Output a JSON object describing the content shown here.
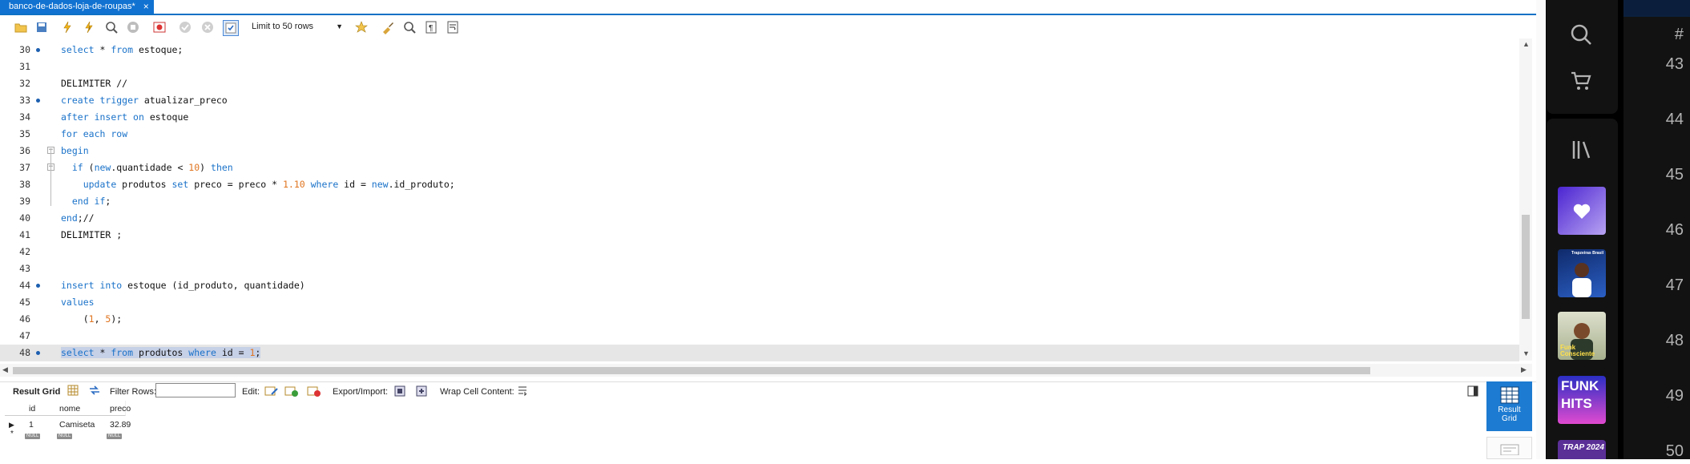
{
  "tab": {
    "title": "banco-de-dados-loja-de-roupas*",
    "close": "×"
  },
  "toolbar": {
    "limit_label": "Limit to 50 rows"
  },
  "editor": {
    "lines": [
      {
        "n": "30",
        "dot": true,
        "code": [
          {
            "k": "kw",
            "t": "select"
          },
          {
            "t": " * "
          },
          {
            "k": "kw",
            "t": "from"
          },
          {
            "t": " estoque;"
          }
        ]
      },
      {
        "n": "31",
        "dot": false,
        "code": []
      },
      {
        "n": "32",
        "dot": false,
        "code": [
          {
            "t": "DELIMITER //"
          }
        ]
      },
      {
        "n": "33",
        "dot": true,
        "code": [
          {
            "k": "kw",
            "t": "create"
          },
          {
            "t": " "
          },
          {
            "k": "kw",
            "t": "trigger"
          },
          {
            "t": " atualizar_preco"
          }
        ]
      },
      {
        "n": "34",
        "dot": false,
        "code": [
          {
            "k": "kw",
            "t": "after"
          },
          {
            "t": " "
          },
          {
            "k": "kw",
            "t": "insert"
          },
          {
            "t": " "
          },
          {
            "k": "kw",
            "t": "on"
          },
          {
            "t": " estoque"
          }
        ]
      },
      {
        "n": "35",
        "dot": false,
        "code": [
          {
            "k": "kw",
            "t": "for"
          },
          {
            "t": " "
          },
          {
            "k": "kw",
            "t": "each"
          },
          {
            "t": " "
          },
          {
            "k": "kw",
            "t": "row"
          }
        ]
      },
      {
        "n": "36",
        "dot": false,
        "fold": true,
        "code": [
          {
            "k": "kw",
            "t": "begin"
          }
        ]
      },
      {
        "n": "37",
        "dot": false,
        "fold": true,
        "code": [
          {
            "t": "  "
          },
          {
            "k": "kw",
            "t": "if"
          },
          {
            "t": " ("
          },
          {
            "k": "kw",
            "t": "new"
          },
          {
            "t": ".quantidade < "
          },
          {
            "k": "num",
            "t": "10"
          },
          {
            "t": ") "
          },
          {
            "k": "kw",
            "t": "then"
          }
        ]
      },
      {
        "n": "38",
        "dot": false,
        "code": [
          {
            "t": "    "
          },
          {
            "k": "kw",
            "t": "update"
          },
          {
            "t": " produtos "
          },
          {
            "k": "kw",
            "t": "set"
          },
          {
            "t": " preco = preco * "
          },
          {
            "k": "num",
            "t": "1.10"
          },
          {
            "t": " "
          },
          {
            "k": "kw",
            "t": "where"
          },
          {
            "t": " id = "
          },
          {
            "k": "kw",
            "t": "new"
          },
          {
            "t": ".id_produto;"
          }
        ]
      },
      {
        "n": "39",
        "dot": false,
        "code": [
          {
            "t": "  "
          },
          {
            "k": "kw",
            "t": "end if"
          },
          {
            "t": ";"
          }
        ]
      },
      {
        "n": "40",
        "dot": false,
        "code": [
          {
            "k": "kw",
            "t": "end"
          },
          {
            "t": ";//"
          }
        ]
      },
      {
        "n": "41",
        "dot": false,
        "code": [
          {
            "t": "DELIMITER ;"
          }
        ]
      },
      {
        "n": "42",
        "dot": false,
        "code": []
      },
      {
        "n": "43",
        "dot": false,
        "code": []
      },
      {
        "n": "44",
        "dot": true,
        "code": [
          {
            "k": "kw",
            "t": "insert"
          },
          {
            "t": " "
          },
          {
            "k": "kw",
            "t": "into"
          },
          {
            "t": " estoque (id_produto, quantidade)"
          }
        ]
      },
      {
        "n": "45",
        "dot": false,
        "code": [
          {
            "k": "kw",
            "t": "values"
          }
        ]
      },
      {
        "n": "46",
        "dot": false,
        "code": [
          {
            "t": "    ("
          },
          {
            "k": "num",
            "t": "1"
          },
          {
            "t": ", "
          },
          {
            "k": "num",
            "t": "5"
          },
          {
            "t": ");"
          }
        ]
      },
      {
        "n": "47",
        "dot": false,
        "code": []
      },
      {
        "n": "48",
        "dot": true,
        "selected": true,
        "code": [
          {
            "k": "kw",
            "t": "select"
          },
          {
            "t": " * "
          },
          {
            "k": "kw",
            "t": "from"
          },
          {
            "t": " produtos "
          },
          {
            "k": "kw",
            "t": "where"
          },
          {
            "t": " id = "
          },
          {
            "k": "num",
            "t": "1"
          },
          {
            "t": ";"
          }
        ]
      }
    ]
  },
  "results": {
    "tab_label": "Result Grid",
    "filter_label": "Filter Rows:",
    "edit_label": "Edit:",
    "export_label": "Export/Import:",
    "wrap_label": "Wrap Cell Content:",
    "columns": [
      "id",
      "nome",
      "preco"
    ],
    "rows": [
      [
        "1",
        "Camiseta",
        "32.89"
      ]
    ],
    "null_label": "NULL",
    "side_button": "Result Grid"
  },
  "spotify": {
    "row_header": "#",
    "row_numbers": [
      "43",
      "44",
      "45",
      "46",
      "47",
      "48",
      "49",
      "50"
    ],
    "cover_texts": {
      "trap_brasil": "Trapzeiras Brasil",
      "funk_consciente": "Funk Consciente",
      "funk_hits": "FUNK HITS",
      "trap_2024": "TRAP 2024"
    }
  }
}
